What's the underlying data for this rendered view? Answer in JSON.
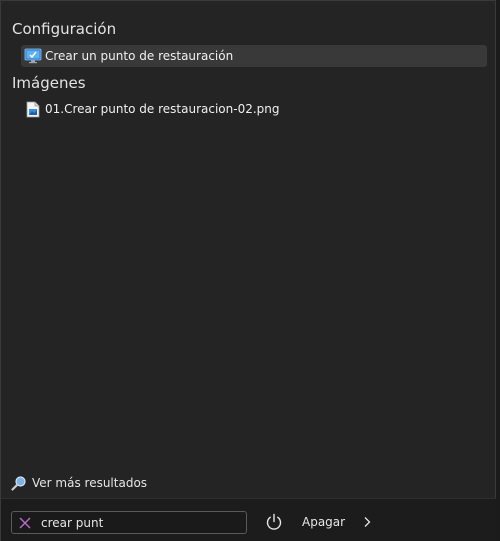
{
  "sections": {
    "settings": {
      "title": "Configuración",
      "items": [
        {
          "label": "Crear un punto de restauración",
          "icon": "system-restore-icon",
          "selected": true
        }
      ]
    },
    "images": {
      "title": "Imágenes",
      "items": [
        {
          "label": "01.Crear punto de restauracion-02.png",
          "icon": "image-file-icon"
        }
      ]
    }
  },
  "more_results": {
    "label": "Ver más resultados",
    "icon": "search-icon"
  },
  "footer": {
    "search": {
      "value": "crear punt",
      "clear_icon": "close-icon"
    },
    "power": {
      "label": "Apagar",
      "icon": "power-icon"
    },
    "chevron_icon": "chevron-right-icon"
  },
  "colors": {
    "panel_bg": "#242424",
    "selected_bg": "#393939",
    "accent_purple": "#b86cc8",
    "text": "#e6e6e6"
  }
}
